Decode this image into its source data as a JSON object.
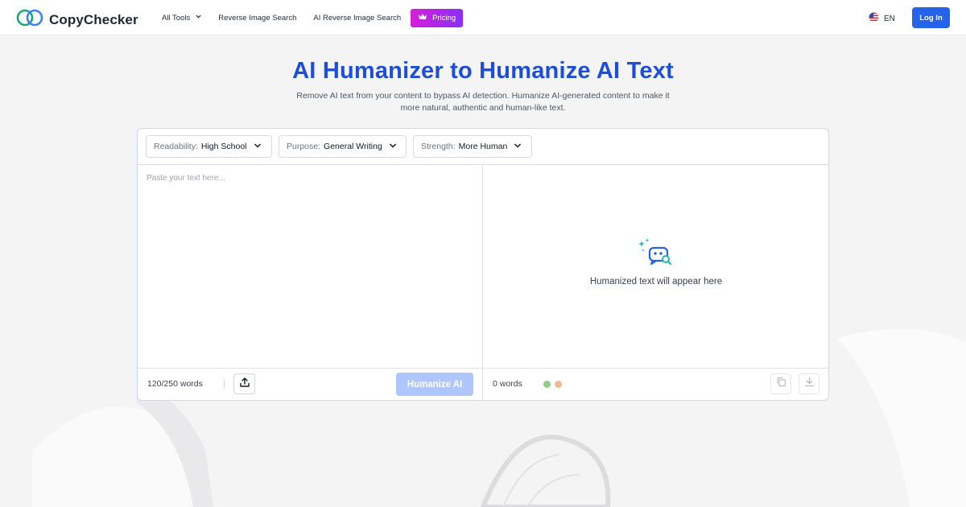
{
  "header": {
    "brand": "CopyChecker",
    "nav": {
      "all_tools": "All Tools",
      "reverse_image_search": "Reverse Image Search",
      "ai_reverse_image_search": "AI Reverse Image Search",
      "pricing": "Pricing"
    },
    "language": "EN",
    "login": "Log In"
  },
  "hero": {
    "title": "AI Humanizer to Humanize AI Text",
    "subtitle_line1": "Remove AI text from your content to bypass AI detection. Humanize AI-generated content to make it",
    "subtitle_line2": "more natural, authentic and human-like text."
  },
  "tool": {
    "options": {
      "readability": {
        "label": "Readability:",
        "value": "High School"
      },
      "purpose": {
        "label": "Purpose:",
        "value": "General Writing"
      },
      "strength": {
        "label": "Strength:",
        "value": "More Human"
      }
    },
    "input": {
      "placeholder": "Paste your text here...",
      "word_limit": "120/250 words"
    },
    "humanize_button": "Humanize AI",
    "output": {
      "empty_text": "Humanized text will appear here",
      "word_count": "0 words"
    }
  },
  "colors": {
    "brand_blue": "#2563eb",
    "title_blue": "#1d4ed8",
    "pricing_gradient_start": "#d41fd8",
    "pricing_gradient_end": "#8b2ff5",
    "humanize_disabled": "#aec6fb",
    "dot_green": "#8fcf8a",
    "dot_orange": "#f2b98e"
  },
  "icons": {
    "logo": "double-ring-logo-icon",
    "all_tools_chevron": "chevron-down-icon",
    "pricing": "crown-icon",
    "language": "us-flag-icon",
    "upload": "upload-icon",
    "empty_state": "robot-search-icon",
    "copy": "copy-icon",
    "download": "download-icon"
  }
}
